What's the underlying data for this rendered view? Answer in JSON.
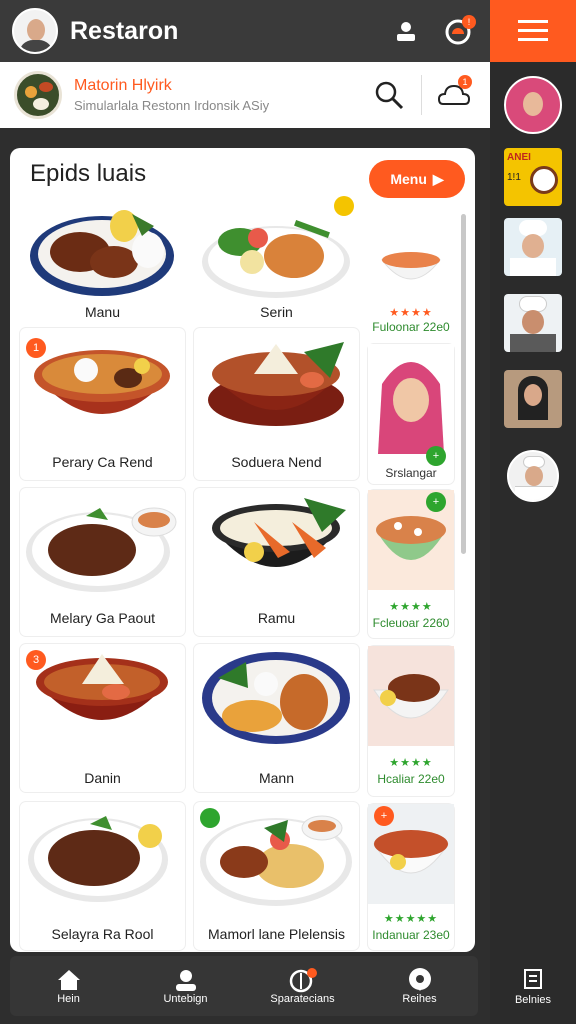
{
  "app": {
    "title": "Restaron"
  },
  "restaurant": {
    "name": "Matorin Hlyirk",
    "subtitle": "Simularlala Restonn Irdonsik ASiy",
    "notification_badge": "1"
  },
  "topbar": {
    "notification_badge": "!"
  },
  "section": {
    "title": "Epids luais",
    "menu_button_label": "Menu"
  },
  "dishes": [
    {
      "label": "Manu",
      "badge": ""
    },
    {
      "label": "Serin",
      "badge": ""
    },
    {
      "label": "Perary Ca Rend",
      "badge": "1"
    },
    {
      "label": "Soduera Nend",
      "badge": ""
    },
    {
      "label": "Melary Ga Paout",
      "badge": ""
    },
    {
      "label": "Ramu",
      "badge": ""
    },
    {
      "label": "Danin",
      "badge": "3"
    },
    {
      "label": "Mann",
      "badge": ""
    },
    {
      "label": "Selayra Ra Rool",
      "badge": ""
    },
    {
      "label": "Mamorl lane Plelensis",
      "badge": ""
    }
  ],
  "side_items": [
    {
      "label": "Fuloonar 22e0",
      "stars": "★★★★",
      "rating": 4
    },
    {
      "label": "Srslangar",
      "stars": "",
      "rating": 0
    },
    {
      "label": "Fcleuoar 2260",
      "stars": "★★★★",
      "rating": 4
    },
    {
      "label": "Hcaliar 22e0",
      "stars": "★★★★",
      "rating": 4
    },
    {
      "label": "Indanuar 23e0",
      "stars": "★★★★★",
      "rating": 5
    }
  ],
  "rail": {
    "promo_line1": "ANEI",
    "promo_line2": "1!1",
    "bottom_label": "Belnies"
  },
  "bottom_nav": [
    {
      "label": "Hein",
      "icon": "home-icon"
    },
    {
      "label": "Untebign",
      "icon": "profile-icon"
    },
    {
      "label": "Sparatecians",
      "icon": "specials-icon"
    },
    {
      "label": "Reihes",
      "icon": "reviews-icon"
    }
  ],
  "colors": {
    "accent": "#ff5a1f",
    "green": "#2e8b2e",
    "dark": "#2e2e2e"
  }
}
